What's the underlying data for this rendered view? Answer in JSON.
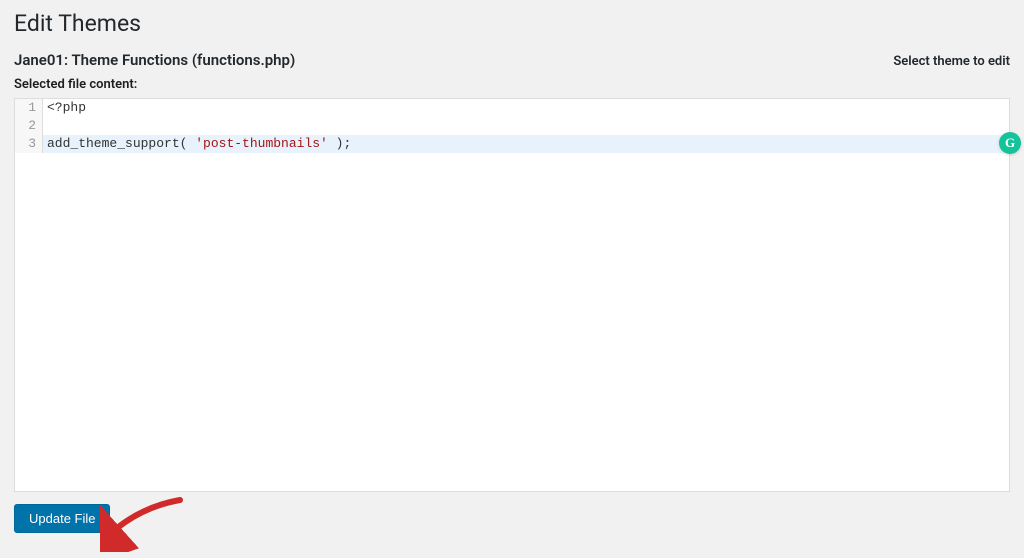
{
  "page": {
    "title": "Edit Themes",
    "current_file_label": "Jane01: Theme Functions (functions.php)",
    "select_theme_label": "Select theme to edit",
    "content_label": "Selected file content:"
  },
  "code": {
    "lines": [
      {
        "num": "1",
        "segments": [
          {
            "t": "<?php",
            "cls": "code-default"
          }
        ],
        "active": false
      },
      {
        "num": "2",
        "segments": [],
        "active": false
      },
      {
        "num": "3",
        "segments": [
          {
            "t": "add_theme_support( ",
            "cls": "code-default"
          },
          {
            "t": "'post-thumbnails'",
            "cls": "code-string"
          },
          {
            "t": " );",
            "cls": "code-default"
          }
        ],
        "active": true
      }
    ]
  },
  "grammarly": {
    "glyph": "G"
  },
  "actions": {
    "update_label": "Update File"
  }
}
